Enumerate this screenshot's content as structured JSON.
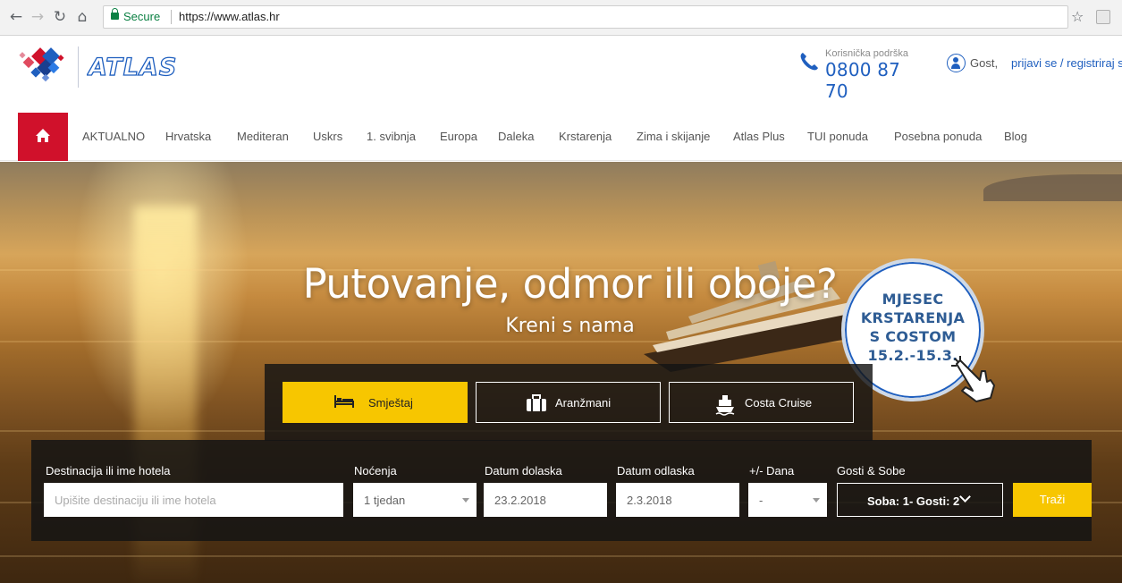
{
  "browser": {
    "back_icon": "arrow-left-icon",
    "forward_icon": "arrow-right-icon",
    "reload_icon": "reload-icon",
    "home_icon": "home-icon",
    "secure_label": "Secure",
    "url": "https://www.atlas.hr",
    "star_icon": "star-icon"
  },
  "header": {
    "logo_text": "ATLAS",
    "support_label": "Korisnička podrška",
    "support_phone": "0800 87 70",
    "guest_label": "Gost,",
    "login_label": "prijavi se / registriraj se"
  },
  "nav": {
    "items": [
      "AKTUALNO",
      "Hrvatska",
      "Mediteran",
      "Uskrs",
      "1. svibnja",
      "Europa",
      "Daleka",
      "Krstarenja",
      "Zima i skijanje",
      "Atlas Plus",
      "TUI ponuda",
      "Posebna ponuda",
      "Blog"
    ]
  },
  "hero": {
    "title": "Putovanje, odmor ili oboje?",
    "subtitle": "Kreni s nama",
    "badge_lines": [
      "MJESEC",
      "KRSTARENJA",
      "S COSTOM",
      "15.2.-15.3."
    ]
  },
  "tabs": [
    {
      "label": "Smještaj",
      "icon": "bed-icon",
      "active": true
    },
    {
      "label": "Aranžmani",
      "icon": "suitcase-icon",
      "active": false
    },
    {
      "label": "Costa Cruise",
      "icon": "ship-icon",
      "active": false
    }
  ],
  "search": {
    "destination_label": "Destinacija ili ime hotela",
    "destination_placeholder": "Upišite destinaciju ili ime hotela",
    "nights_label": "Noćenja",
    "nights_value": "1 tjedan",
    "arrival_label": "Datum dolaska",
    "arrival_value": "23.2.2018",
    "departure_label": "Datum odlaska",
    "departure_value": "2.3.2018",
    "flex_label": "+/- Dana",
    "flex_value": "-",
    "guests_label": "Gosti & Sobe",
    "guests_value": "Soba: 1- Gosti: 2",
    "submit_label": "Traži"
  },
  "colors": {
    "brand_red": "#d0112b",
    "brand_blue": "#1f5fbf",
    "accent_yellow": "#f7c600"
  }
}
